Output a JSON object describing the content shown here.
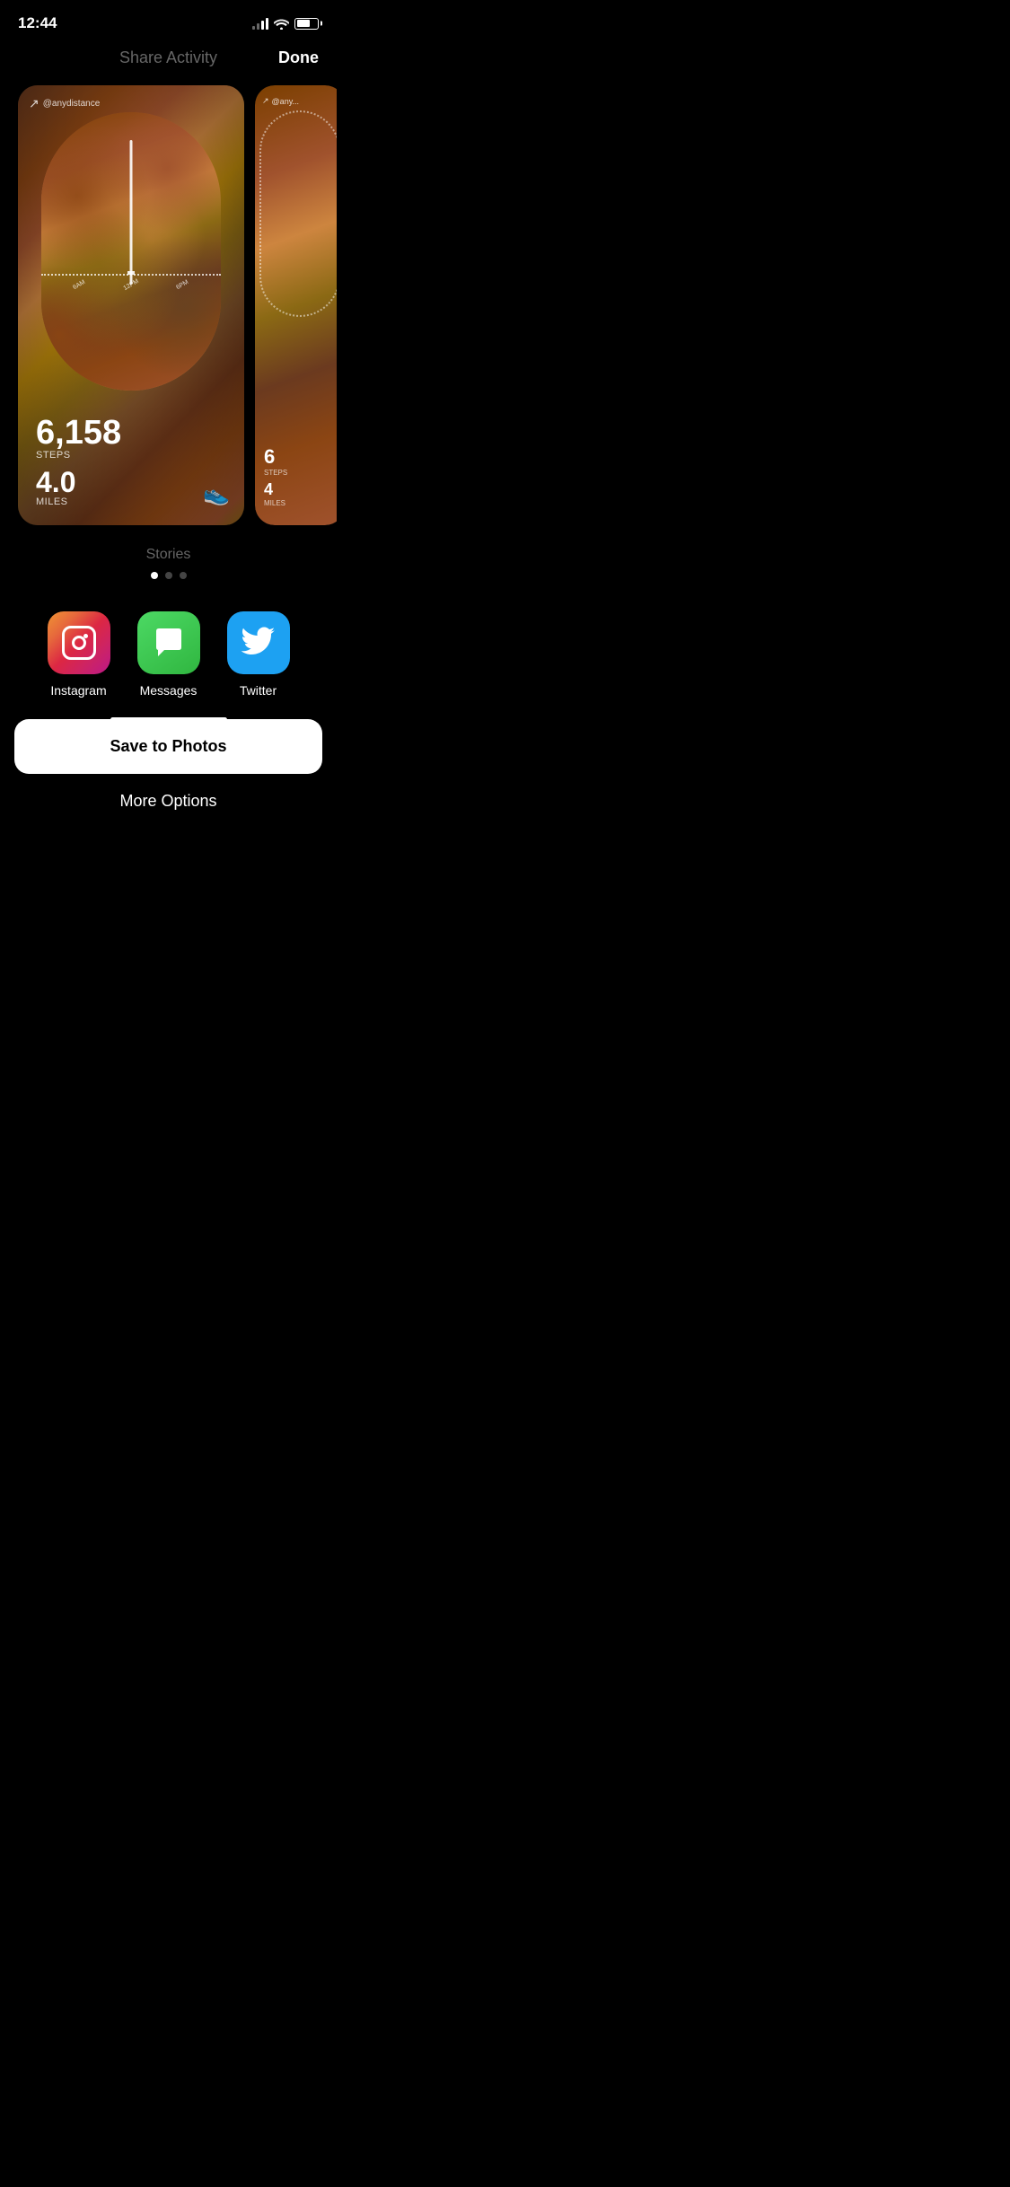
{
  "statusBar": {
    "time": "12:44",
    "batteryLevel": 65
  },
  "header": {
    "title": "Share Activity",
    "doneLabel": "Done"
  },
  "activityCard": {
    "brand": "@anydistance",
    "steps": {
      "value": "6,158",
      "label": "STEPS"
    },
    "miles": {
      "value": "4.0",
      "label": "MILES"
    },
    "timeLabels": [
      "6AM",
      "12PM",
      "6PM"
    ]
  },
  "stories": {
    "label": "Stories",
    "dots": [
      {
        "active": true
      },
      {
        "active": false
      },
      {
        "active": false
      }
    ]
  },
  "shareApps": [
    {
      "id": "instagram",
      "label": "Instagram"
    },
    {
      "id": "messages",
      "label": "Messages"
    },
    {
      "id": "twitter",
      "label": "Twitter"
    }
  ],
  "saveButton": {
    "label": "Save to Photos"
  },
  "moreOptions": {
    "label": "More Options"
  }
}
